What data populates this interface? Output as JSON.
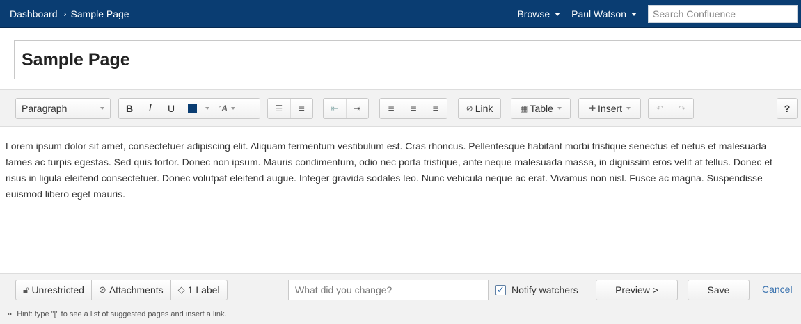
{
  "topbar": {
    "breadcrumbs": [
      "Dashboard",
      "Sample Page"
    ],
    "browse_label": "Browse",
    "user_label": "Paul Watson",
    "search_placeholder": "Search Confluence"
  },
  "page": {
    "title": "Sample Page"
  },
  "toolbar": {
    "paragraph_format": "Paragraph",
    "bold": "B",
    "italic": "I",
    "underline": "U",
    "text_color": "#0a3d72",
    "link_label": "Link",
    "table_label": "Table",
    "insert_label": "Insert",
    "help_label": "?",
    "icons": [
      "text-color-icon",
      "text-style-icon",
      "bullet-list-icon",
      "numbered-list-icon",
      "outdent-icon",
      "indent-icon",
      "align-left-icon",
      "align-center-icon",
      "align-right-icon",
      "link-icon",
      "table-icon",
      "insert-icon",
      "undo-icon",
      "redo-icon"
    ]
  },
  "editor": {
    "body_text": "Lorem ipsum dolor sit amet, consectetuer adipiscing elit. Aliquam fermentum vestibulum est. Cras rhoncus. Pellentesque habitant morbi tristique senectus et netus et malesuada fames ac turpis egestas. Sed quis tortor. Donec non ipsum. Mauris condimentum, odio nec porta tristique, ante neque malesuada massa, in dignissim eros velit at tellus. Donec et risus in ligula eleifend consectetuer. Donec volutpat eleifend augue. Integer gravida sodales leo. Nunc vehicula neque ac erat. Vivamus non nisl. Fusce ac magna. Suspendisse euismod libero eget mauris."
  },
  "footer": {
    "restrictions_label": "Unrestricted",
    "attachments_label": "Attachments",
    "labels_label": "1 Label",
    "change_placeholder": "What did you change?",
    "notify_label": "Notify watchers",
    "notify_checked": true,
    "preview_label": "Preview >",
    "save_label": "Save",
    "cancel_label": "Cancel",
    "hint_text": "Hint: type \"[\" to see a list of suggested pages and insert a link."
  },
  "colors": {
    "nav_bg": "#0a3d72",
    "link": "#3b73af",
    "toolbar_bg": "#f2f2f2"
  }
}
